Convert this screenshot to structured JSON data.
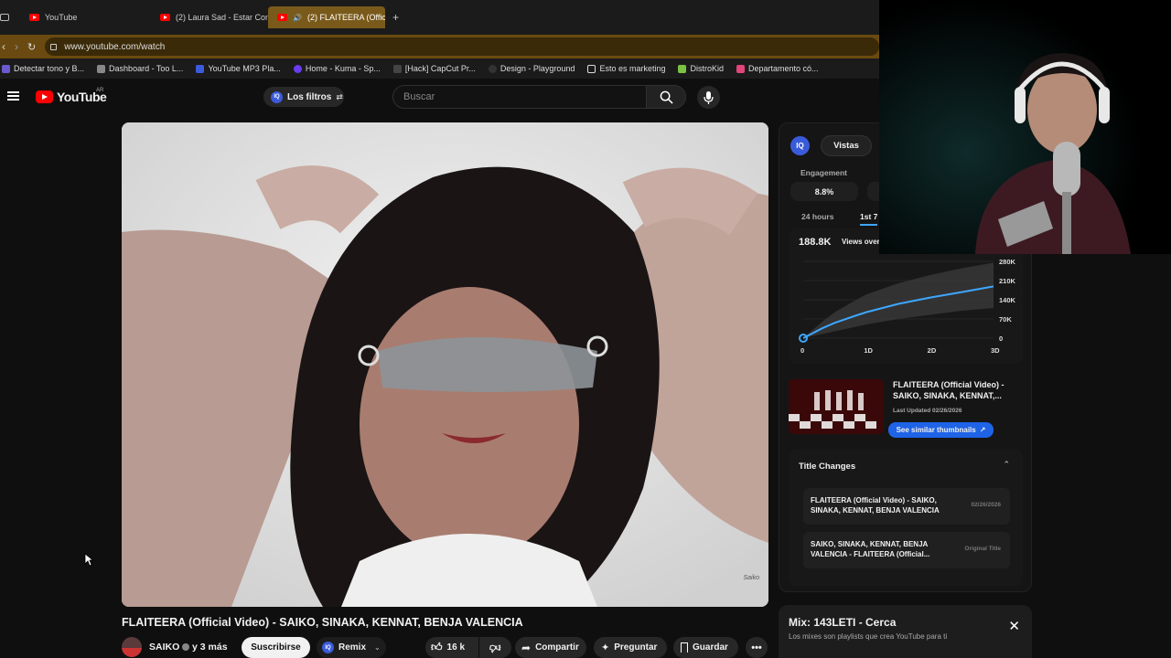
{
  "browser": {
    "tabs": [
      {
        "label": "YouTube"
      },
      {
        "label": "(2) Laura Sad - Estar Cont"
      },
      {
        "label": "(2) FLAITEERA (Officia"
      }
    ],
    "new_tab_label": "+",
    "url": "www.youtube.com/watch",
    "bookmarks": [
      {
        "label": "Detectar tono y B...",
        "color": "#6a5acd"
      },
      {
        "label": "Dashboard - Too L...",
        "color": "#888888"
      },
      {
        "label": "YouTube MP3 Pla...",
        "color": "#3b5bdb"
      },
      {
        "label": "Home - Kuma - Sp...",
        "color": "#6a3df0"
      },
      {
        "label": "[Hack] CapCut Pr...",
        "color": "#444444"
      },
      {
        "label": "Design - Playground",
        "color": "#333333"
      },
      {
        "label": "Esto es marketing",
        "color": "#dddddd"
      },
      {
        "label": "DistroKid",
        "color": "#7cc242"
      },
      {
        "label": "Departamento có...",
        "color": "#e0457b"
      }
    ]
  },
  "youtube": {
    "logo": "YouTube",
    "region": "AR",
    "filters_label": "Los filtros",
    "search_placeholder": "Buscar"
  },
  "video": {
    "title": "FLAITEERA (Official Video) - SAIKO, SINAKA, KENNAT, BENJA VALENCIA",
    "watermark": "Saiko"
  },
  "channel": {
    "name": "SAIKO",
    "more": "y 3 más",
    "subscribe": "Suscribirse",
    "remix": "Remix",
    "likes": "16 k",
    "share": "Compartir",
    "ask": "Preguntar",
    "save": "Guardar"
  },
  "side": {
    "tab_active": "Vistas",
    "engagement_label": "Engagement",
    "engagement_value": "8.8%",
    "range_a": "24 hours",
    "range_b": "1st 7",
    "views_value": "188.8K",
    "views_label": "Views over",
    "thumb_title": "FLAITEERA (Official Video) - SAIKO, SINAKA, KENNAT,...",
    "thumb_updated": "Last Updated 02/26/2026",
    "similar_button": "See similar thumbnails",
    "title_changes_heading": "Title Changes",
    "title_changes": [
      {
        "title": "FLAITEERA (Official Video) - SAIKO, SINAKA, KENNAT, BENJA VALENCIA",
        "date": "02/26/2026"
      },
      {
        "title": "SAIKO, SINAKA, KENNAT, BENJA VALENCIA - FLAITEERA (Official...",
        "date": "Original Title"
      }
    ],
    "mix_title": "Mix: 143LETI - Cerca",
    "mix_subtitle": "Los mixes son playlists que crea YouTube para ti"
  },
  "chart_data": {
    "type": "area",
    "x": [
      0,
      1,
      2,
      3,
      5,
      8,
      10,
      15,
      20,
      25,
      30
    ],
    "x_ticks": [
      "0",
      "1D",
      "2D",
      "3D"
    ],
    "x_tick_values": [
      0,
      10,
      20,
      30
    ],
    "y_ticks": [
      "280K",
      "210K",
      "140K",
      "70K",
      "0"
    ],
    "ylim": [
      0,
      280000
    ],
    "series": [
      {
        "values": [
          0,
          12000,
          24000,
          36000,
          56000,
          80000,
          95000,
          125000,
          148000,
          168000,
          188800
        ]
      }
    ],
    "band_upper": [
      0,
      20000,
      40000,
      60000,
      95000,
      135000,
      160000,
      200000,
      230000,
      255000,
      275000
    ],
    "band_lower": [
      0,
      5000,
      10000,
      15000,
      25000,
      40000,
      50000,
      70000,
      85000,
      100000,
      110000
    ],
    "colors": {
      "line": "#3ea6ff",
      "band": "#3a3a3a"
    }
  },
  "colors": {
    "accent": "#3ea6ff",
    "youtube_red": "#ff0000",
    "iq_blue": "#3a5bd9",
    "similar_button": "#1f63e6",
    "url_bar": "#6a4a10"
  }
}
